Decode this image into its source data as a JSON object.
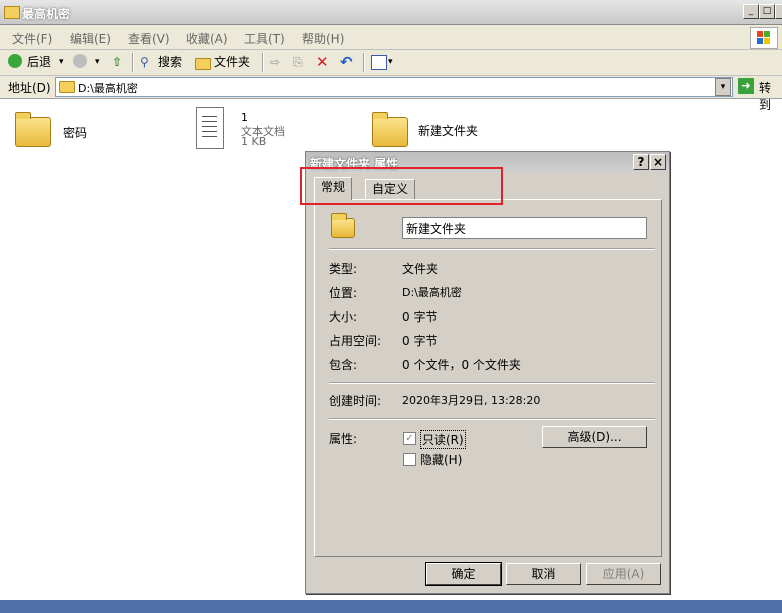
{
  "window": {
    "title": "最高机密"
  },
  "menu": [
    "文件(F)",
    "编辑(E)",
    "查看(V)",
    "收藏(A)",
    "工具(T)",
    "帮助(H)"
  ],
  "toolbar": {
    "back": "后退",
    "search": "搜索",
    "folders": "文件夹"
  },
  "address": {
    "label": "地址(D)",
    "path": "D:\\最高机密",
    "go": "转到"
  },
  "files": [
    {
      "name": "密码"
    },
    {
      "name": "1",
      "type": "文本文档",
      "size": "1 KB"
    },
    {
      "name": "新建文件夹"
    }
  ],
  "dialog": {
    "title": "新建文件夹 属性",
    "help_btn": "?",
    "close_btn": "×",
    "tabs": [
      "常规",
      "自定义"
    ],
    "folder_name": "新建文件夹",
    "rows": [
      {
        "label": "类型:",
        "value": "文件夹"
      },
      {
        "label": "位置:",
        "value": "D:\\最高机密"
      },
      {
        "label": "大小:",
        "value": "0 字节"
      },
      {
        "label": "占用空间:",
        "value": "0 字节"
      },
      {
        "label": "包含:",
        "value": "0 个文件，0 个文件夹"
      }
    ],
    "created_label": "创建时间:",
    "created_value": "2020年3月29日, 13:28:20",
    "attr_label": "属性:",
    "readonly_label": "只读(R)",
    "hidden_label": "隐藏(H)",
    "advanced_btn": "高级(D)...",
    "ok": "确定",
    "cancel": "取消",
    "apply": "应用(A)"
  },
  "colors": {
    "highlight": "#e0222a"
  }
}
